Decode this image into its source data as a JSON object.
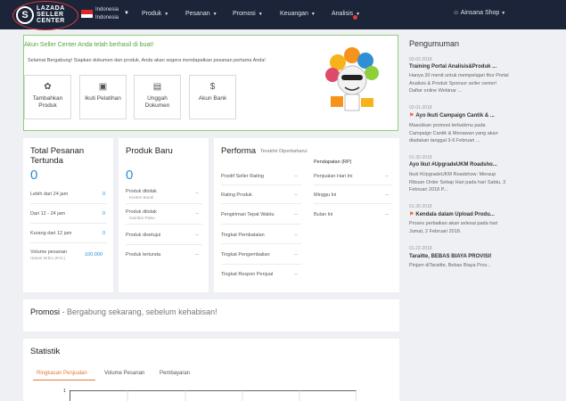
{
  "header": {
    "brand_line1": "LAZADA",
    "brand_line2": "SELLER",
    "brand_line3": "CENTER",
    "country_line1": "Indonesia",
    "country_line2": "Indonesia",
    "nav": [
      "Produk",
      "Pesanan",
      "Promosi",
      "Keuangan",
      "Analisis"
    ],
    "user": "Ainsana Shop",
    "colors": {
      "bar": "#1b2438",
      "alert": "#e23a3a"
    }
  },
  "welcome": {
    "title": "Akun Seller Center Anda telah berhasil di buat!",
    "desc": "Selamat Bergabung! Siapkan dokumen dan produk, Anda akan segera mendapatkan pesanan pertama Anda!",
    "actions": [
      {
        "label": "Tambahkan Produk",
        "icon": "grid-icon"
      },
      {
        "label": "Ikuti Pelatihan",
        "icon": "presentation-icon"
      },
      {
        "label": "Unggah Dokumen",
        "icon": "document-icon"
      },
      {
        "label": "Akun Bank",
        "icon": "dollar-icon"
      }
    ]
  },
  "orders": {
    "title": "Total Pesanan Tertunda",
    "total": "0",
    "rows": [
      {
        "label": "Lebih dari 24 jam",
        "value": "0"
      },
      {
        "label": "Dari 12 - 24 jam",
        "value": "0"
      },
      {
        "label": "Kurang dari 12 jam",
        "value": "0"
      },
      {
        "label": "Volume pesanan",
        "sub": "Hanari terbru (KVL)",
        "value": "100.000"
      }
    ]
  },
  "products": {
    "title": "Produk Baru",
    "total": "0",
    "rows": [
      {
        "label": "Produk ditolak",
        "sub": "Konten Buruk",
        "value": "--"
      },
      {
        "label": "Produk ditolak",
        "sub": "Gambar Palsu",
        "value": "--"
      },
      {
        "label": "Produk disetujui",
        "value": "--"
      },
      {
        "label": "Produk tertunda",
        "value": "--"
      }
    ]
  },
  "performance": {
    "title": "Performa",
    "subtitle": "Terakhir Diperbaharui",
    "income_header": "Pendapatan (RP)",
    "left_rows": [
      {
        "label": "Positif Seller Rating",
        "value": "--"
      },
      {
        "label": "Rating Produk",
        "value": "--"
      },
      {
        "label": "Pengiriman Tepat Waktu",
        "value": "--"
      },
      {
        "label": "Tingkat Pembatalan",
        "value": "--"
      },
      {
        "label": "Tingkat Pengembalian",
        "value": "--"
      },
      {
        "label": "Tingkat Respon Penjual",
        "value": "--"
      }
    ],
    "right_rows": [
      {
        "label": "Penjualan Hari Ini",
        "value": "--"
      },
      {
        "label": "Minggu Ini",
        "value": "--"
      },
      {
        "label": "Bulan Ini",
        "value": "--"
      }
    ]
  },
  "promo": {
    "title": "Promosi",
    "tagline": "- Bergabung sekarang, sebelum kehabisan!"
  },
  "stats": {
    "title": "Statistik",
    "tabs": [
      "Ringkasan Penjualan",
      "Volume Pesanan",
      "Pembayaran"
    ],
    "axis_value": "1"
  },
  "announcements": {
    "title": "Pengumuman",
    "items": [
      {
        "date": "02-02-2018",
        "title": "Training Portal Analisis&Produk ...",
        "body": "Hanya 30 menit untuk mempelajari fitur Portal Analisis & Produk Sponsor seller center! Daftar online Webinar ...",
        "flag": false
      },
      {
        "date": "02-01-2018",
        "title": "Ayo Ikuti Campaign Cantik & ...",
        "body": "Masukkan promosi terbaikmu pada Campaign Cantik & Menawan yang akan diadakan tanggal 3-6 Februari ...",
        "flag": true
      },
      {
        "date": "01-30-2018",
        "title": "Ayo Ikut #UpgradeUKM Roadsho...",
        "body": "Ikuti #UpgradeUKM Roadshow: Meraup Ribuan Order Setiap Hari pada hari Sabtu, 3 Februari 2018 P...",
        "flag": false
      },
      {
        "date": "01-30-2018",
        "title": "Kendala dalam Upload Produ...",
        "body": "Proses perbaikan akan selesai pada hari Jumat, 2 Februari 2018.",
        "flag": true
      },
      {
        "date": "01-22-2018",
        "title": "Taraitte, BEBAS BIAYA PROVISI!",
        "body": "Pinjam diTaraitte, Bebas Biaya Prov...",
        "flag": false
      }
    ]
  }
}
